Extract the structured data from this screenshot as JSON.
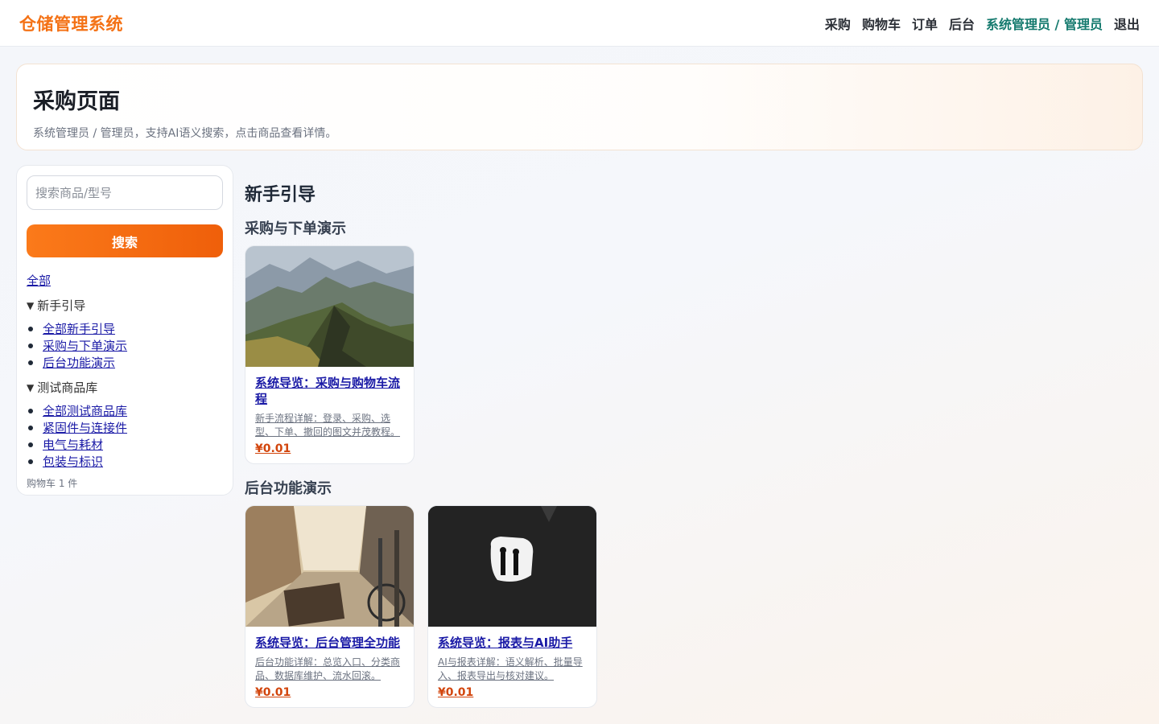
{
  "header": {
    "brand": "仓储管理系统",
    "nav": {
      "purchase": "采购",
      "cart": "购物车",
      "orders": "订单",
      "admin": "后台",
      "user": "系统管理员 / 管理员",
      "logout": "退出"
    }
  },
  "hero": {
    "title": "采购页面",
    "subtitle": "系统管理员 / 管理员，支持AI语义搜索，点击商品查看详情。"
  },
  "sidebar": {
    "search_placeholder": "搜索商品/型号",
    "search_value": "",
    "search_button": "搜索",
    "all_label": "全部",
    "groups": [
      {
        "title": "新手引导",
        "items": [
          "全部新手引导",
          "采购与下单演示",
          "后台功能演示"
        ]
      },
      {
        "title": "测试商品库",
        "items": [
          "全部测试商品库",
          "紧固件与连接件",
          "电气与耗材",
          "包装与标识"
        ]
      }
    ],
    "cart_count": "购物车 1 件"
  },
  "main": {
    "heading": "新手引导",
    "sections": [
      {
        "title": "采购与下单演示",
        "cards": [
          {
            "image": "mountain-photo",
            "title": "系统导览：采购与购物车流程",
            "desc": "新手流程详解：登录、采购、选型、下单、撤回的图文并茂教程。",
            "price": "¥0.01"
          }
        ]
      },
      {
        "title": "后台功能演示",
        "cards": [
          {
            "image": "street-photo",
            "title": "系统导览：后台管理全功能",
            "desc": "后台功能详解：总览入口、分类商品、数据库维护、流水回滚。",
            "price": "¥0.01"
          },
          {
            "image": "tunnel-photo",
            "title": "系统导览：报表与AI助手",
            "desc": "AI与报表详解：语义解析、批量导入、报表导出与核对建议。",
            "price": "¥0.01"
          }
        ]
      }
    ]
  }
}
